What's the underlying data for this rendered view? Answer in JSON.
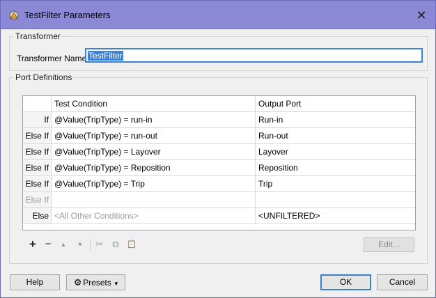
{
  "window": {
    "title": "TestFilter Parameters",
    "close_glyph": "✕"
  },
  "transformer": {
    "group_title": "Transformer",
    "name_label": "Transformer Name:",
    "name_value": "TestFilter"
  },
  "ports": {
    "group_title": "Port Definitions",
    "headers": {
      "prefix": "",
      "condition": "Test Condition",
      "output": "Output Port"
    },
    "rows": [
      {
        "prefix": "If",
        "condition": "@Value(TripType) = run-in",
        "output": "Run-in"
      },
      {
        "prefix": "Else If",
        "condition": "@Value(TripType) = run-out",
        "output": "Run-out"
      },
      {
        "prefix": "Else If",
        "condition": "@Value(TripType) = Layover",
        "output": "Layover"
      },
      {
        "prefix": "Else If",
        "condition": "@Value(TripType) = Reposition",
        "output": "Reposition"
      },
      {
        "prefix": "Else If",
        "condition": "@Value(TripType) = Trip",
        "output": "Trip"
      },
      {
        "prefix": "Else If",
        "condition": "",
        "output": ""
      },
      {
        "prefix": "Else",
        "condition": "<All Other Conditions>",
        "output": "<UNFILTERED>"
      }
    ]
  },
  "toolbar": {
    "add": "+",
    "remove": "−",
    "move_up": "▲",
    "move_down": "▼",
    "cut": "✂",
    "copy": "⧉",
    "paste": "📋",
    "edit_label": "Edit..."
  },
  "footer": {
    "help_label": "Help",
    "presets_label": "Presets",
    "ok_label": "OK",
    "cancel_label": "Cancel"
  },
  "colors": {
    "titlebar": "#8b88d6",
    "focus": "#3b82d6"
  }
}
